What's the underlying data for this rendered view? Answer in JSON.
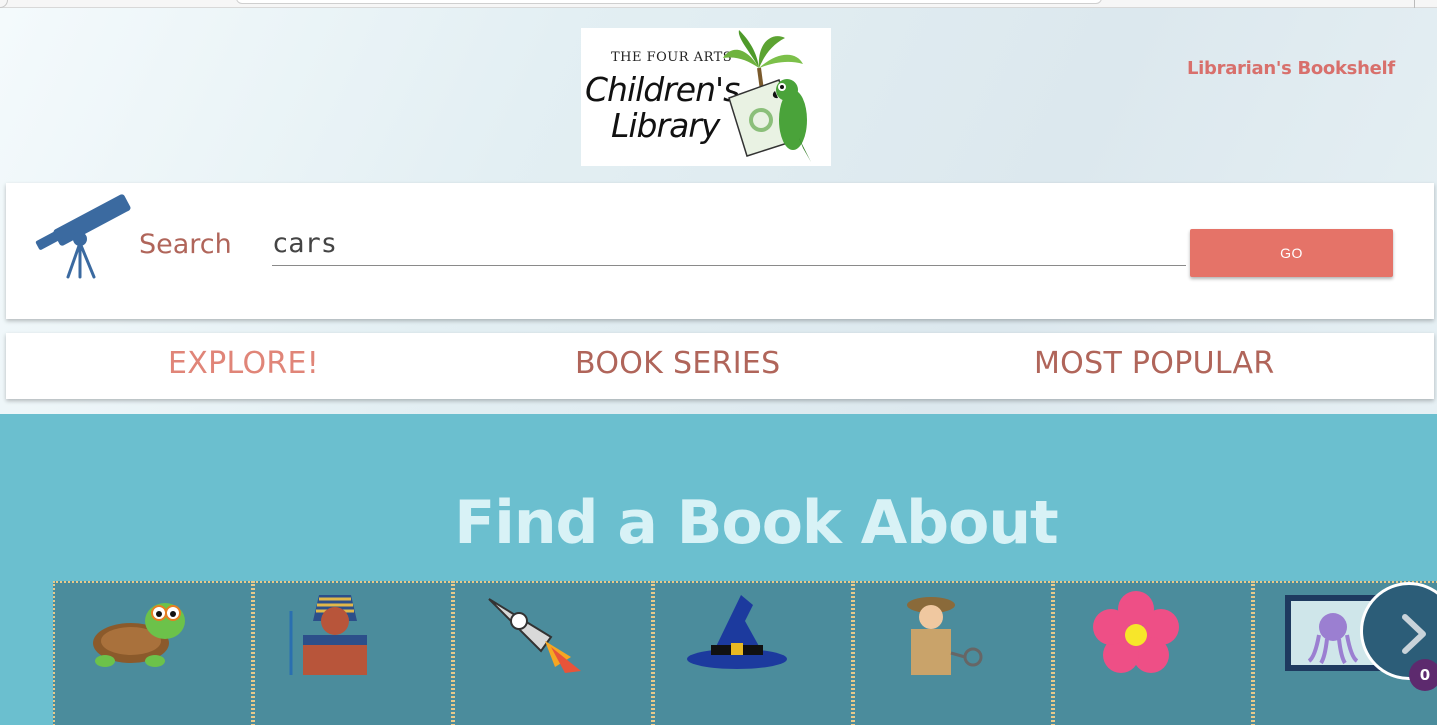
{
  "header": {
    "logo": {
      "top_text": "THE FOUR ARTS",
      "line1": "Children's",
      "line2": "Library"
    },
    "librarian_link": "Librarian's Bookshelf"
  },
  "search": {
    "label": "Search",
    "value": "cars",
    "button_label": "GO"
  },
  "nav": {
    "items": [
      {
        "label": "EXPLORE!"
      },
      {
        "label": "BOOK SERIES"
      },
      {
        "label": "MOST POPULAR"
      }
    ]
  },
  "section": {
    "title": "Find a Book About"
  },
  "carousel": {
    "tiles": [
      {
        "icon": "turtle-icon"
      },
      {
        "icon": "pharaoh-icon"
      },
      {
        "icon": "rocket-icon"
      },
      {
        "icon": "wizard-hat-icon"
      },
      {
        "icon": "detective-icon"
      },
      {
        "icon": "flower-icon"
      },
      {
        "icon": "octopus-picture-icon"
      }
    ]
  },
  "cart": {
    "count": "0"
  },
  "colors": {
    "accent": "#e57368",
    "nav_text": "#b0655a",
    "page_bg": "#6bbfcf",
    "tile_bg": "#4b8c9c",
    "next_button": "#2c5d78",
    "badge": "#5d2a6e"
  }
}
